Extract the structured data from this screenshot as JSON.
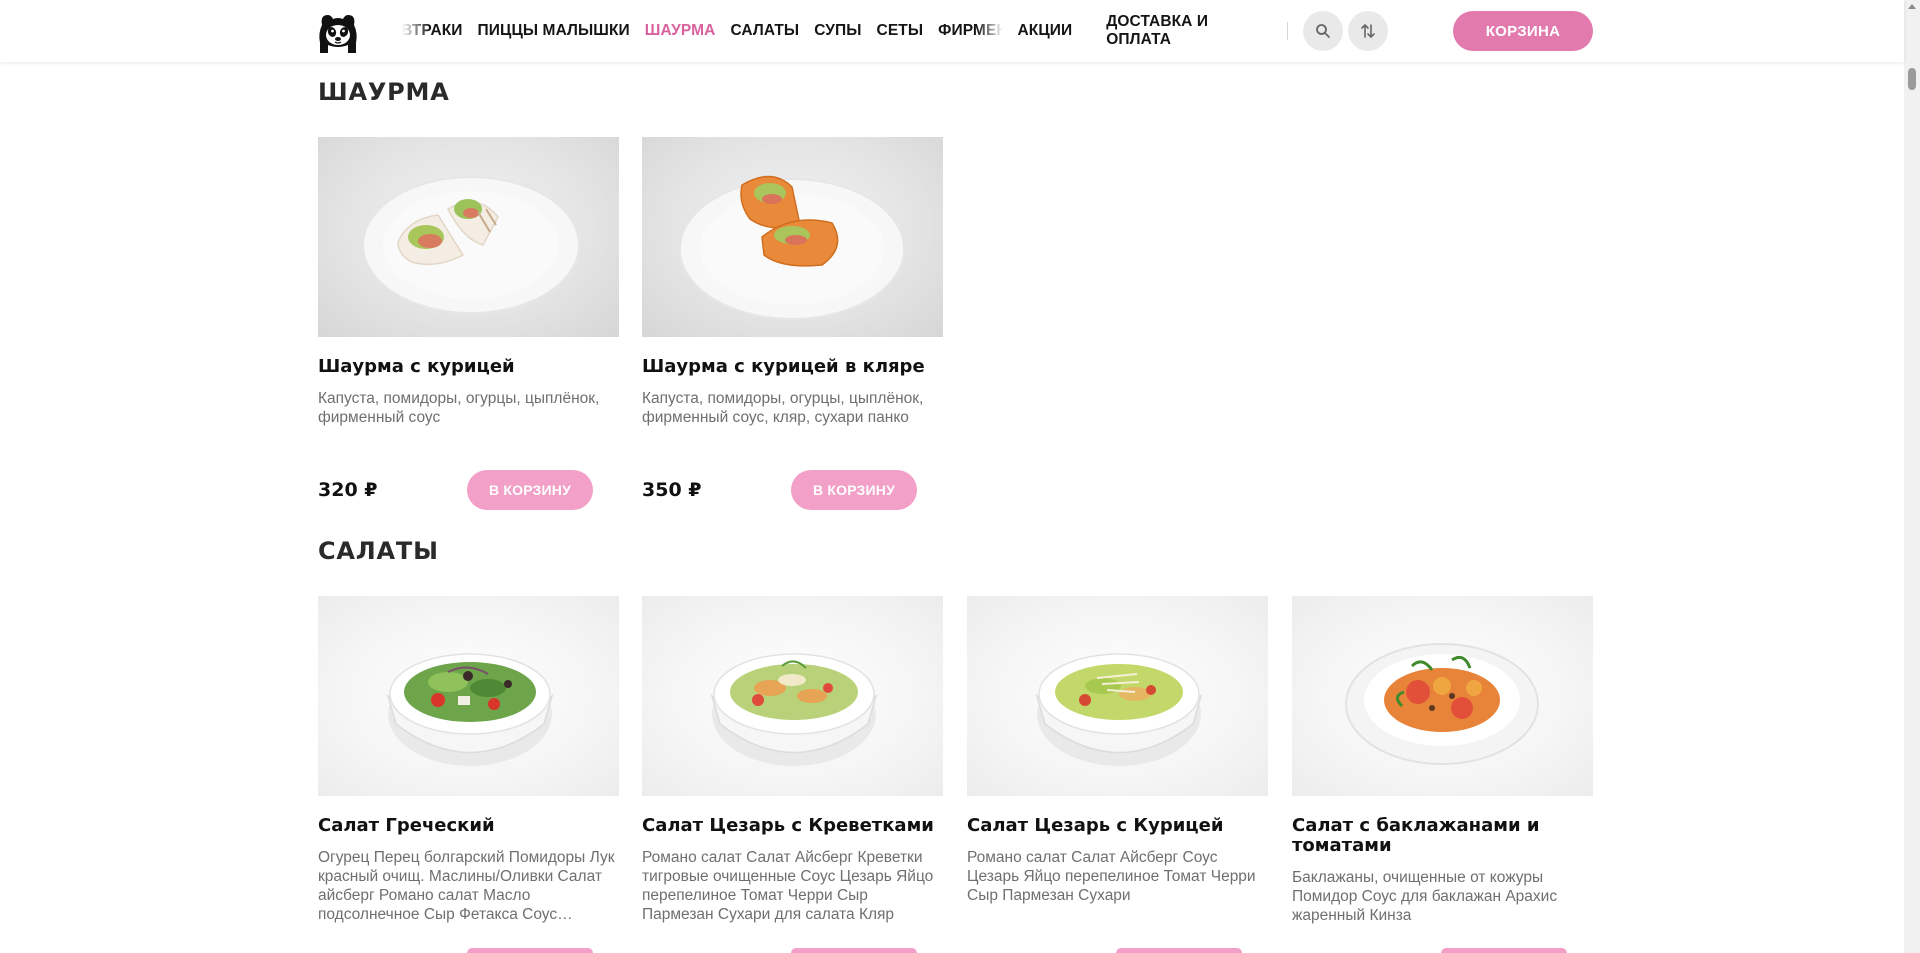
{
  "header": {
    "logo_alt": "logo",
    "nav_items": [
      {
        "label": "ЗАВТРАКИ",
        "active": false
      },
      {
        "label": "ПИЦЦЫ МАЛЫШКИ",
        "active": false
      },
      {
        "label": "ШАУРМА",
        "active": true
      },
      {
        "label": "САЛАТЫ",
        "active": false
      },
      {
        "label": "СУПЫ",
        "active": false
      },
      {
        "label": "СЕТЫ",
        "active": false
      },
      {
        "label": "ФИРМЕННЫЕ РОЛЛЫ",
        "active": false
      }
    ],
    "extra_links": [
      "АКЦИИ",
      "ДОСТАВКА И ОПЛАТА"
    ],
    "search_icon": "search-icon",
    "sort_icon": "sort-icon",
    "cart_label": "КОРЗИНА",
    "accent_color": "#e37aae",
    "active_color": "#d8619e"
  },
  "sections": {
    "shaurma": {
      "title": "ШАУРМА",
      "items": [
        {
          "name": "Шаурма с курицей",
          "description": "Капуста, помидоры, огурцы, цыплёнок, фирменный соус",
          "price": "320 ₽",
          "button": "В КОРЗИНУ"
        },
        {
          "name": "Шаурма с курицей в кляре",
          "description": "Капуста, помидоры, огурцы, цыплёнок, фирменный соус, кляр, сухари панко",
          "price": "350 ₽",
          "button": "В КОРЗИНУ"
        }
      ]
    },
    "salads": {
      "title": "САЛАТЫ",
      "items": [
        {
          "name": "Салат Греческий",
          "description": "Огурец Перец болгарский Помидоры Лук красный очищ. Маслины/Оливки Салат айсберг Романо салат Масло подсолнечное Сыр Фетакса Соус…"
        },
        {
          "name": "Салат Цезарь с Креветками",
          "description": "Романо салат Салат Айсберг Креветки тигровые очищенные Соус Цезарь Яйцо перепелиное Томат Черри Сыр Пармезан Сухари для салата Кляр"
        },
        {
          "name": "Салат Цезарь с Курицей",
          "description": "Романо салат Салат Айсберг Соус Цезарь Яйцо перепелиное Томат Черри Сыр Пармезан Сухари"
        },
        {
          "name": "Салат с баклажанами и томатами",
          "description": "Баклажаны, очищенные от кожуры Помидор Соус для баклажан Арахис жаренный Кинза"
        }
      ]
    }
  }
}
